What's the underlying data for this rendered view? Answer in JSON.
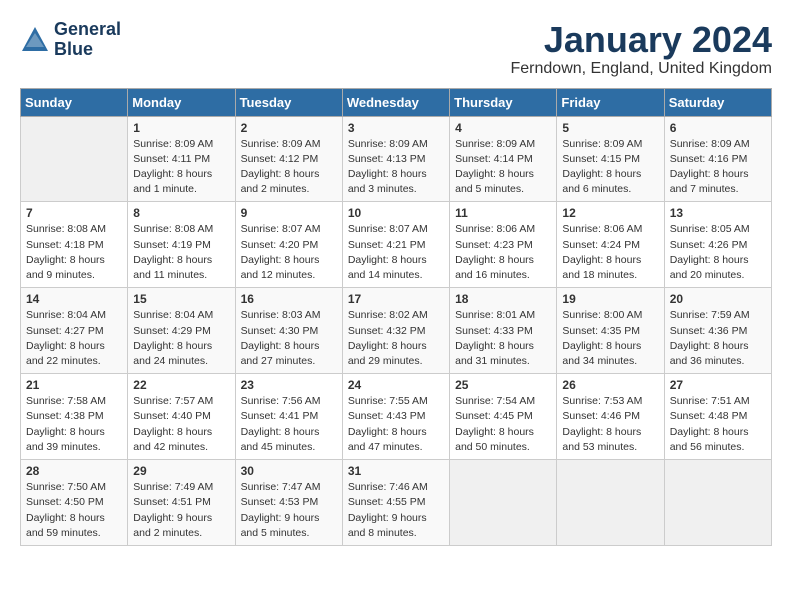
{
  "header": {
    "logo_line1": "General",
    "logo_line2": "Blue",
    "title": "January 2024",
    "location": "Ferndown, England, United Kingdom"
  },
  "days_of_week": [
    "Sunday",
    "Monday",
    "Tuesday",
    "Wednesday",
    "Thursday",
    "Friday",
    "Saturday"
  ],
  "weeks": [
    [
      {
        "day": "",
        "info": ""
      },
      {
        "day": "1",
        "info": "Sunrise: 8:09 AM\nSunset: 4:11 PM\nDaylight: 8 hours\nand 1 minute."
      },
      {
        "day": "2",
        "info": "Sunrise: 8:09 AM\nSunset: 4:12 PM\nDaylight: 8 hours\nand 2 minutes."
      },
      {
        "day": "3",
        "info": "Sunrise: 8:09 AM\nSunset: 4:13 PM\nDaylight: 8 hours\nand 3 minutes."
      },
      {
        "day": "4",
        "info": "Sunrise: 8:09 AM\nSunset: 4:14 PM\nDaylight: 8 hours\nand 5 minutes."
      },
      {
        "day": "5",
        "info": "Sunrise: 8:09 AM\nSunset: 4:15 PM\nDaylight: 8 hours\nand 6 minutes."
      },
      {
        "day": "6",
        "info": "Sunrise: 8:09 AM\nSunset: 4:16 PM\nDaylight: 8 hours\nand 7 minutes."
      }
    ],
    [
      {
        "day": "7",
        "info": "Sunrise: 8:08 AM\nSunset: 4:18 PM\nDaylight: 8 hours\nand 9 minutes."
      },
      {
        "day": "8",
        "info": "Sunrise: 8:08 AM\nSunset: 4:19 PM\nDaylight: 8 hours\nand 11 minutes."
      },
      {
        "day": "9",
        "info": "Sunrise: 8:07 AM\nSunset: 4:20 PM\nDaylight: 8 hours\nand 12 minutes."
      },
      {
        "day": "10",
        "info": "Sunrise: 8:07 AM\nSunset: 4:21 PM\nDaylight: 8 hours\nand 14 minutes."
      },
      {
        "day": "11",
        "info": "Sunrise: 8:06 AM\nSunset: 4:23 PM\nDaylight: 8 hours\nand 16 minutes."
      },
      {
        "day": "12",
        "info": "Sunrise: 8:06 AM\nSunset: 4:24 PM\nDaylight: 8 hours\nand 18 minutes."
      },
      {
        "day": "13",
        "info": "Sunrise: 8:05 AM\nSunset: 4:26 PM\nDaylight: 8 hours\nand 20 minutes."
      }
    ],
    [
      {
        "day": "14",
        "info": "Sunrise: 8:04 AM\nSunset: 4:27 PM\nDaylight: 8 hours\nand 22 minutes."
      },
      {
        "day": "15",
        "info": "Sunrise: 8:04 AM\nSunset: 4:29 PM\nDaylight: 8 hours\nand 24 minutes."
      },
      {
        "day": "16",
        "info": "Sunrise: 8:03 AM\nSunset: 4:30 PM\nDaylight: 8 hours\nand 27 minutes."
      },
      {
        "day": "17",
        "info": "Sunrise: 8:02 AM\nSunset: 4:32 PM\nDaylight: 8 hours\nand 29 minutes."
      },
      {
        "day": "18",
        "info": "Sunrise: 8:01 AM\nSunset: 4:33 PM\nDaylight: 8 hours\nand 31 minutes."
      },
      {
        "day": "19",
        "info": "Sunrise: 8:00 AM\nSunset: 4:35 PM\nDaylight: 8 hours\nand 34 minutes."
      },
      {
        "day": "20",
        "info": "Sunrise: 7:59 AM\nSunset: 4:36 PM\nDaylight: 8 hours\nand 36 minutes."
      }
    ],
    [
      {
        "day": "21",
        "info": "Sunrise: 7:58 AM\nSunset: 4:38 PM\nDaylight: 8 hours\nand 39 minutes."
      },
      {
        "day": "22",
        "info": "Sunrise: 7:57 AM\nSunset: 4:40 PM\nDaylight: 8 hours\nand 42 minutes."
      },
      {
        "day": "23",
        "info": "Sunrise: 7:56 AM\nSunset: 4:41 PM\nDaylight: 8 hours\nand 45 minutes."
      },
      {
        "day": "24",
        "info": "Sunrise: 7:55 AM\nSunset: 4:43 PM\nDaylight: 8 hours\nand 47 minutes."
      },
      {
        "day": "25",
        "info": "Sunrise: 7:54 AM\nSunset: 4:45 PM\nDaylight: 8 hours\nand 50 minutes."
      },
      {
        "day": "26",
        "info": "Sunrise: 7:53 AM\nSunset: 4:46 PM\nDaylight: 8 hours\nand 53 minutes."
      },
      {
        "day": "27",
        "info": "Sunrise: 7:51 AM\nSunset: 4:48 PM\nDaylight: 8 hours\nand 56 minutes."
      }
    ],
    [
      {
        "day": "28",
        "info": "Sunrise: 7:50 AM\nSunset: 4:50 PM\nDaylight: 8 hours\nand 59 minutes."
      },
      {
        "day": "29",
        "info": "Sunrise: 7:49 AM\nSunset: 4:51 PM\nDaylight: 9 hours\nand 2 minutes."
      },
      {
        "day": "30",
        "info": "Sunrise: 7:47 AM\nSunset: 4:53 PM\nDaylight: 9 hours\nand 5 minutes."
      },
      {
        "day": "31",
        "info": "Sunrise: 7:46 AM\nSunset: 4:55 PM\nDaylight: 9 hours\nand 8 minutes."
      },
      {
        "day": "",
        "info": ""
      },
      {
        "day": "",
        "info": ""
      },
      {
        "day": "",
        "info": ""
      }
    ]
  ]
}
